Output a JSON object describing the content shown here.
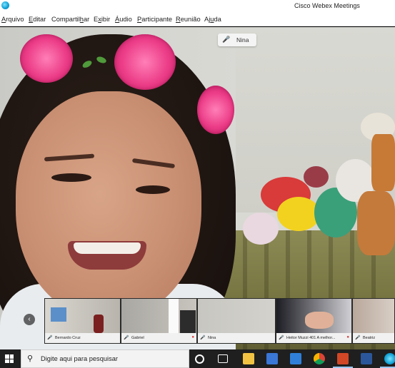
{
  "window": {
    "title": "Cisco Webex Meetings"
  },
  "menu": [
    {
      "pre": "",
      "ul": "A",
      "post": "rquivo"
    },
    {
      "pre": "",
      "ul": "E",
      "post": "ditar"
    },
    {
      "pre": "Compartil",
      "ul": "h",
      "post": "ar"
    },
    {
      "pre": "E",
      "ul": "x",
      "post": "ibir"
    },
    {
      "pre": "",
      "ul": "Á",
      "post": "udio"
    },
    {
      "pre": "",
      "ul": "P",
      "post": "articipante"
    },
    {
      "pre": "",
      "ul": "R",
      "post": "eunião"
    },
    {
      "pre": "Aj",
      "ul": "u",
      "post": "da"
    }
  ],
  "active_speaker": {
    "name": "Nina",
    "mic_icon": "microphone-icon"
  },
  "filmstrip": {
    "participants": [
      {
        "name": "Bernardo Cruz",
        "muted": false
      },
      {
        "name": "Gabriel",
        "muted": true
      },
      {
        "name": "Nina",
        "muted": false
      },
      {
        "name": "Heitor Muzzi 401 A melhor...",
        "muted": true
      },
      {
        "name": "Beatriz",
        "muted": false
      }
    ]
  },
  "taskbar": {
    "search_placeholder": "Digite aqui para pesquisar",
    "icons": [
      "cortana-icon",
      "task-view-icon",
      "file-explorer-icon",
      "store-icon",
      "mail-icon",
      "chrome-icon",
      "powerpoint-icon",
      "word-icon",
      "webex-icon"
    ]
  },
  "colors": {
    "flower_pink": "#ec3d88",
    "taskbar_bg": "#1f1f1f",
    "webex_blue": "#12a3d6"
  }
}
